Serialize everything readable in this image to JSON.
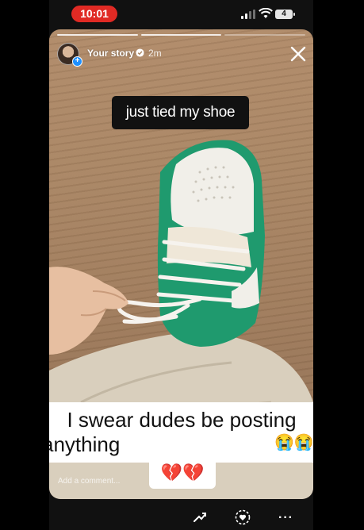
{
  "status_bar": {
    "time": "10:01",
    "battery": "4"
  },
  "story": {
    "username": "Your story",
    "age": "2m",
    "caption": "just tied my shoe",
    "comment_placeholder": "Add a comment..."
  },
  "overlay": {
    "line1": "I swear dudes be posting",
    "line2": "anything",
    "emoji_end": "😭😭",
    "emoji_bottom": "💔💔"
  },
  "colors": {
    "time_pill": "#e02a24",
    "sneaker_green": "#1f9a6e",
    "floor": "#a98563"
  },
  "icons": [
    "signal-icon",
    "wifi-icon",
    "battery-icon",
    "verified-icon",
    "close-icon",
    "trending-icon",
    "heart-icon",
    "more-icon"
  ]
}
